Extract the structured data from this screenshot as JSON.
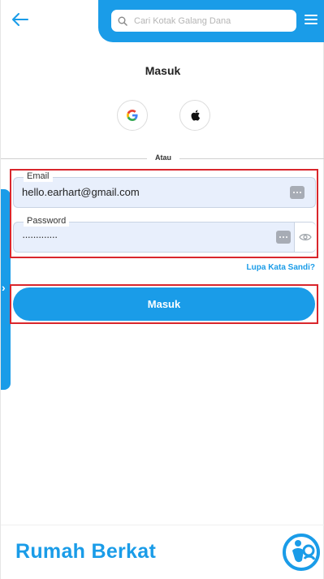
{
  "header": {
    "search_placeholder": "Cari Kotak Galang Dana",
    "icons": {
      "back": "arrow-left-icon",
      "search": "search-icon",
      "menu": "hamburger-menu-icon"
    }
  },
  "page": {
    "title": "Masuk"
  },
  "social_login": {
    "google": "google-icon",
    "apple": "apple-icon"
  },
  "divider_text": "Atau",
  "form": {
    "email_label": "Email",
    "email_value": "hello.earhart@gmail.com",
    "password_label": "Password",
    "password_masked": "·············",
    "forgot_link": "Lupa Kata Sandi?",
    "submit_label": "Masuk"
  },
  "footer": {
    "brand_name": "Rumah Berkat"
  },
  "colors": {
    "accent": "#1a9ce8",
    "field_bg": "#e8effc",
    "highlight": "#d9262c"
  }
}
